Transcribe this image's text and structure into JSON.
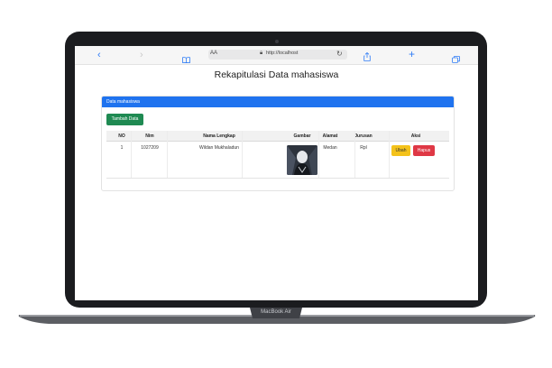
{
  "device": {
    "model_label": "MacBook Air"
  },
  "browser": {
    "text_size_label": "AA",
    "url": "http://localhost",
    "icons": [
      "back-icon",
      "forward-icon",
      "book-icon",
      "lock-icon",
      "reload-icon",
      "share-icon",
      "new-tab-icon",
      "tabs-icon"
    ]
  },
  "page": {
    "title": "Rekapitulasi Data mahasiswa"
  },
  "card": {
    "header": "Data mahasiswa",
    "add_button": "Tambah Data",
    "header_color": "#1f73ef",
    "add_button_color": "#1f8a52"
  },
  "table": {
    "columns": [
      "NO",
      "Nim",
      "Nama Lengkap",
      "Gambar",
      "Alamat",
      "Jurusan",
      "Aksi"
    ],
    "rows": [
      {
        "no": "1",
        "nim": "1027209",
        "nama": "Wildan Mukhaladun",
        "gambar_icon": "profile-photo",
        "alamat": "Medan",
        "jurusan": "Rpl",
        "edit_label": "Ubah",
        "delete_label": "Hapus"
      }
    ]
  },
  "colors": {
    "edit": "#f4c21a",
    "delete": "#df3845"
  }
}
